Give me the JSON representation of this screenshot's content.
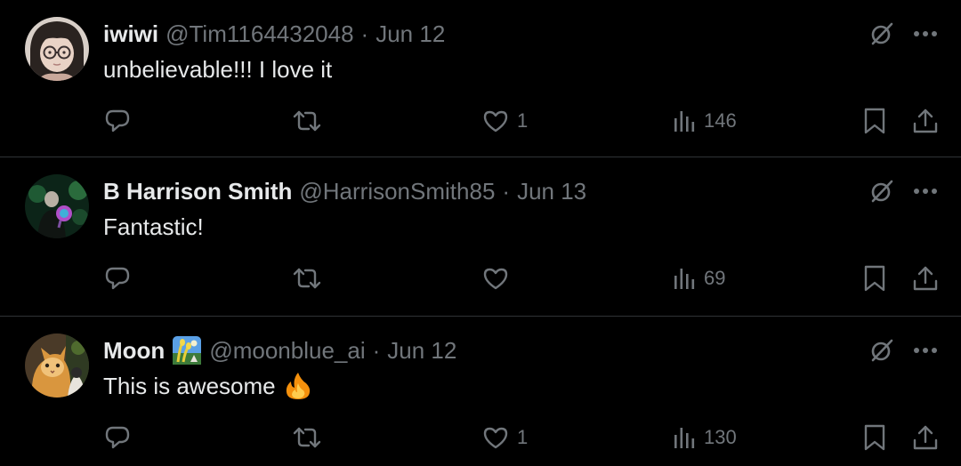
{
  "tweets": [
    {
      "name": "iwiwi",
      "handle": "@Tim1164432048",
      "separator": "·",
      "date": "Jun 12",
      "text": "unbelievable!!! I love it",
      "likes": "1",
      "views": "146"
    },
    {
      "name": "B Harrison Smith",
      "handle": "@HarrisonSmith85",
      "separator": "·",
      "date": "Jun 13",
      "text": "Fantastic!",
      "likes": "",
      "views": "69"
    },
    {
      "name": "Moon",
      "handle": "@moonblue_ai",
      "separator": "·",
      "date": "Jun 12",
      "text": "This is awesome",
      "likes": "1",
      "views": "130"
    }
  ],
  "icons": {
    "reply": "reply-icon",
    "retweet": "retweet-icon",
    "like": "heart-icon",
    "views": "views-chart-icon",
    "bookmark": "bookmark-icon",
    "share": "share-icon",
    "grok": "grok-icon",
    "more": "more-dots-icon"
  },
  "colors": {
    "background": "#000000",
    "primary_text": "#e7e9ea",
    "secondary_text": "#71767b",
    "separator": "#2f3336"
  }
}
